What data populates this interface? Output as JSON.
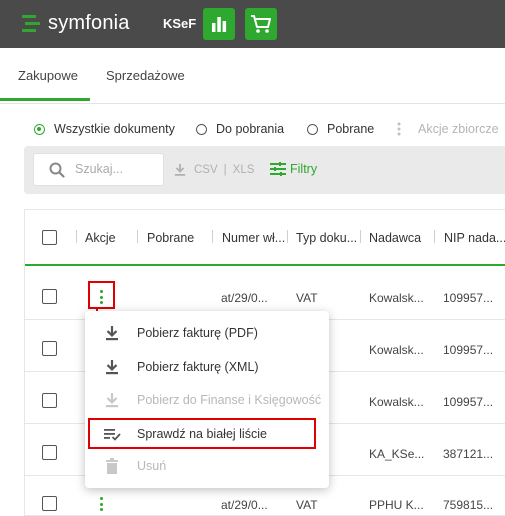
{
  "brand": {
    "name": "symfonia",
    "product": "KSeF"
  },
  "header": {
    "apps": [
      "chart-app-icon",
      "cart-app-icon"
    ]
  },
  "tabs": [
    {
      "label": "Zakupowe",
      "active": true
    },
    {
      "label": "Sprzedażowe",
      "active": false
    }
  ],
  "filters": {
    "options": [
      {
        "label": "Wszystkie dokumenty",
        "selected": true
      },
      {
        "label": "Do pobrania",
        "selected": false
      },
      {
        "label": "Pobrane",
        "selected": false
      }
    ],
    "bulk_actions": "Akcje zbiorcze"
  },
  "toolbar": {
    "search_placeholder": "Szukaj...",
    "csv": "CSV",
    "sep": "|",
    "xls": "XLS",
    "filters_label": "Filtry"
  },
  "table": {
    "columns": [
      "Akcje",
      "Pobrane",
      "Numer wł...",
      "Typ doku...",
      "Nadawca",
      "NIP nada..."
    ],
    "rows": [
      {
        "numer": "at/29/0...",
        "typ": "VAT",
        "nadawca": "Kowalsk...",
        "nip": "109957..."
      },
      {
        "numer": "",
        "typ": "",
        "nadawca": "Kowalsk...",
        "nip": "109957..."
      },
      {
        "numer": "",
        "typ": "",
        "nadawca": "Kowalsk...",
        "nip": "109957..."
      },
      {
        "numer": "",
        "typ": "",
        "nadawca": "KA_KSe...",
        "nip": "387121..."
      },
      {
        "numer": "at/29/0...",
        "typ": "VAT",
        "nadawca": "PPHU K...",
        "nip": "759815..."
      }
    ]
  },
  "menu": {
    "items": [
      {
        "label": "Pobierz fakturę (PDF)",
        "icon": "download-icon",
        "disabled": false
      },
      {
        "label": "Pobierz fakturę (XML)",
        "icon": "download-icon",
        "disabled": false
      },
      {
        "label": "Pobierz do Finanse i Księgowość",
        "icon": "download-icon",
        "disabled": true
      },
      {
        "label": "Sprawdź na białej liście",
        "icon": "playlist-check-icon",
        "disabled": false
      },
      {
        "label": "Usuń",
        "icon": "trash-icon",
        "disabled": true
      }
    ]
  },
  "colors": {
    "accent": "#2ea82e",
    "topbar": "#4a4a4a",
    "highlight": "#e00000"
  }
}
